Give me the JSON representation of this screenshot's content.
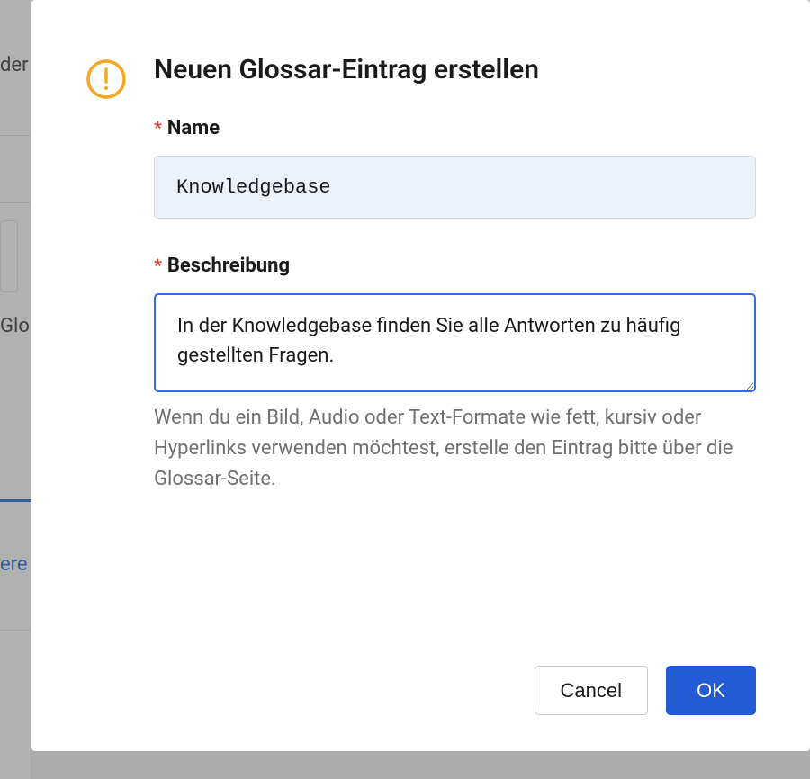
{
  "modal": {
    "title": "Neuen Glossar-Eintrag erstellen",
    "nameLabel": "Name",
    "nameValue": "Knowledgebase",
    "descriptionLabel": "Beschreibung",
    "descriptionValue": "In der Knowledgebase finden Sie alle Antworten zu häufig gestellten Fragen.",
    "helpText": "Wenn du ein Bild, Audio oder Text-Formate wie fett, kursiv oder Hyperlinks verwenden möchtest, erstelle den Eintrag bitte über die Glossar-Seite.",
    "cancelLabel": "Cancel",
    "okLabel": "OK",
    "requiredSymbol": "*"
  },
  "background": {
    "text1": "der",
    "text2": "Glo",
    "text3": "ere"
  },
  "colors": {
    "primary": "#215bd6",
    "warning": "#f5a623",
    "required": "#e03e2d",
    "inputBg": "#edf2fa",
    "focusBorder": "#2f6fed"
  }
}
